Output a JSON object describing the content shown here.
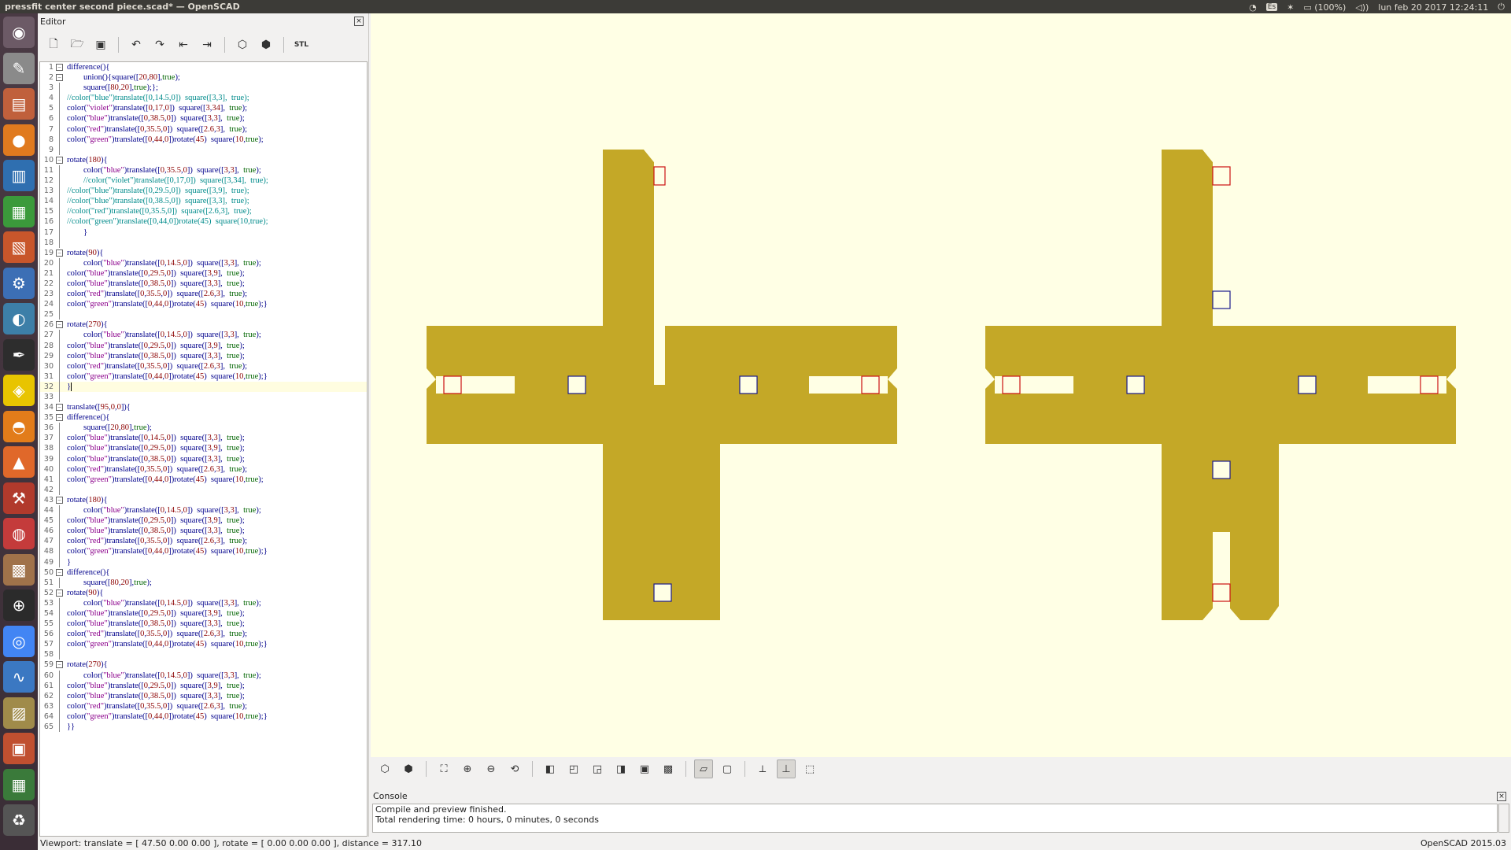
{
  "topbar": {
    "window_title": "pressfit center second piece.scad* — OpenSCAD",
    "keyboard": "Es",
    "battery": "(100%)",
    "datetime": "lun feb 20 2017 12:24:11"
  },
  "launcher": {
    "items": [
      "dash-icon",
      "text-editor-icon",
      "files-icon",
      "firefox-icon",
      "writer-icon",
      "calc-icon",
      "impress-icon",
      "settings-icon",
      "shutter-icon",
      "inkscape-icon",
      "openscad-icon",
      "blender-icon",
      "software-center-icon",
      "system-settings-icon",
      "pidgin-icon",
      "library-icon",
      "crosshair-icon",
      "chromium-icon",
      "sysmon-icon",
      "disk-icon",
      "terminal-icon",
      "workspace-icon",
      "trash-icon"
    ]
  },
  "editor": {
    "title": "Editor",
    "close": "×"
  },
  "code_lines": [
    "difference(){",
    "        union(){square([20,80],true);",
    "        square([80,20],true);};",
    "//color(\"blue\")translate([0,14.5,0])  square([3,3],  true);",
    "color(\"violet\")translate([0,17,0])  square([3,34],  true);",
    "color(\"blue\")translate([0,38.5,0])  square([3,3],  true);",
    "color(\"red\")translate([0,35.5,0])  square([2.6,3],  true);",
    "color(\"green\")translate([0,44,0])rotate(45)  square(10,true);",
    "",
    "rotate(180){",
    "        color(\"blue\")translate([0,35.5,0])  square([3,3],  true);",
    "        //color(\"violet\")translate([0,17,0])  square([3,34],  true);",
    "//color(\"blue\")translate([0,29.5,0])  square([3,9],  true);",
    "//color(\"blue\")translate([0,38.5,0])  square([3,3],  true);",
    "//color(\"red\")translate([0,35.5,0])  square([2.6,3],  true);",
    "//color(\"green\")translate([0,44,0])rotate(45)  square(10,true);",
    "        }",
    "",
    "rotate(90){",
    "        color(\"blue\")translate([0,14.5,0])  square([3,3],  true);",
    "color(\"blue\")translate([0,29.5,0])  square([3,9],  true);",
    "color(\"blue\")translate([0,38.5,0])  square([3,3],  true);",
    "color(\"red\")translate([0,35.5,0])  square([2.6,3],  true);",
    "color(\"green\")translate([0,44,0])rotate(45)  square(10,true);}",
    "",
    "rotate(270){",
    "        color(\"blue\")translate([0,14.5,0])  square([3,3],  true);",
    "color(\"blue\")translate([0,29.5,0])  square([3,9],  true);",
    "color(\"blue\")translate([0,38.5,0])  square([3,3],  true);",
    "color(\"red\")translate([0,35.5,0])  square([2.6,3],  true);",
    "color(\"green\")translate([0,44,0])rotate(45)  square(10,true);}",
    "}",
    "",
    "translate([95,0,0]){",
    "difference(){",
    "        square([20,80],true);",
    "color(\"blue\")translate([0,14.5,0])  square([3,3],  true);",
    "color(\"blue\")translate([0,29.5,0])  square([3,9],  true);",
    "color(\"blue\")translate([0,38.5,0])  square([3,3],  true);",
    "color(\"red\")translate([0,35.5,0])  square([2.6,3],  true);",
    "color(\"green\")translate([0,44,0])rotate(45)  square(10,true);",
    "",
    "rotate(180){",
    "        color(\"blue\")translate([0,14.5,0])  square([3,3],  true);",
    "color(\"blue\")translate([0,29.5,0])  square([3,9],  true);",
    "color(\"blue\")translate([0,38.5,0])  square([3,3],  true);",
    "color(\"red\")translate([0,35.5,0])  square([2.6,3],  true);",
    "color(\"green\")translate([0,44,0])rotate(45)  square(10,true);}",
    "}",
    "difference(){",
    "        square([80,20],true);",
    "rotate(90){",
    "        color(\"blue\")translate([0,14.5,0])  square([3,3],  true);",
    "color(\"blue\")translate([0,29.5,0])  square([3,9],  true);",
    "color(\"blue\")translate([0,38.5,0])  square([3,3],  true);",
    "color(\"red\")translate([0,35.5,0])  square([2.6,3],  true);",
    "color(\"green\")translate([0,44,0])rotate(45)  square(10,true);}",
    "",
    "rotate(270){",
    "        color(\"blue\")translate([0,14.5,0])  square([3,3],  true);",
    "color(\"blue\")translate([0,29.5,0])  square([3,9],  true);",
    "color(\"blue\")translate([0,38.5,0])  square([3,3],  true);",
    "color(\"red\")translate([0,35.5,0])  square([2.6,3],  true);",
    "color(\"green\")translate([0,44,0])rotate(45)  square(10,true);}",
    "}}"
  ],
  "fold_lines": [
    1,
    2,
    10,
    19,
    26,
    34,
    35,
    43,
    50,
    52,
    59
  ],
  "current_line": 32,
  "console": {
    "title": "Console",
    "close": "×",
    "lines": [
      "Compile and preview finished.",
      "Total rendering time: 0 hours, 0 minutes, 0 seconds"
    ]
  },
  "statusbar": {
    "viewport": "Viewport: translate = [ 47.50 0.00 0.00 ], rotate = [ 0.00 0.00 0.00 ], distance = 317.10",
    "version": "OpenSCAD 2015.03"
  },
  "colors": {
    "model": "#c4a827",
    "viewport_bg": "#ffffe5",
    "blue": "#1a1a8c",
    "red": "#cc1111"
  }
}
